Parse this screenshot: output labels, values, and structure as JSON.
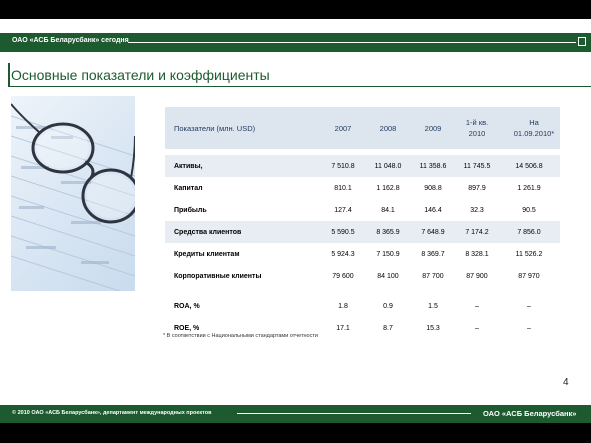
{
  "header": {
    "company": "ОАО «АСБ Беларусбанк» сегодня"
  },
  "title": "Основные показатели и коэффициенты",
  "table": {
    "columns": [
      "Показатели (млн. USD)",
      "2007",
      "2008",
      "2009",
      "1-й кв.\n2010",
      "На\n01.09.2010*"
    ],
    "rows": [
      [
        "Активы,",
        "7 510.8",
        "11 048.0",
        "11 358.6",
        "11 745.5",
        "14 506.8"
      ],
      [
        "Капитал",
        "810.1",
        "1 162.8",
        "908.8",
        "897.9",
        "1 261.9"
      ],
      [
        "Прибыль",
        "127.4",
        "84.1",
        "146.4",
        "32.3",
        "90.5"
      ],
      [
        "Средства клиентов",
        "5 590.5",
        "8 365.9",
        "7 648.9",
        "7 174.2",
        "7 856.0"
      ],
      [
        "Кредиты клиентам",
        "5 924.3",
        "7 150.9",
        "8 369.7",
        "8 328.1",
        "11 526.2"
      ],
      [
        "Корпоративные клиенты",
        "79 600",
        "84 100",
        "87 700",
        "87 900",
        "87 970"
      ],
      [
        "ROA, %",
        "1.8",
        "0.9",
        "1.5",
        "–",
        "–"
      ],
      [
        "ROE, %",
        "17.1",
        "8.7",
        "15.3",
        "–",
        "–"
      ]
    ]
  },
  "footnote": "* В соответствии с Национальными стандартами отчетности",
  "page_number": "4",
  "footer": {
    "left": "© 2010 ОАО «АСБ Беларусбанк», департамент международных проектов",
    "right": "ОАО «АСБ Беларусбанк»"
  },
  "colors": {
    "brand_green": "#1e5a30",
    "header_band": "#dde5ef",
    "row_shade": "#e8edf4"
  }
}
